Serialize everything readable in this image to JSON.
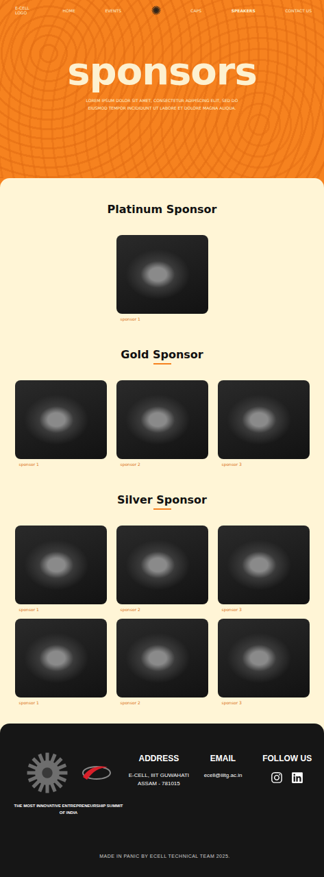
{
  "nav": {
    "logo": "E-CELL LOGO",
    "links_left": [
      {
        "label": "HOME",
        "selected": false
      },
      {
        "label": "EVENTS",
        "selected": false
      }
    ],
    "links_right": [
      {
        "label": "CAPS",
        "selected": false
      },
      {
        "label": "SPEAKERS",
        "selected": true
      },
      {
        "label": "CONTACT US",
        "selected": false
      }
    ]
  },
  "hero": {
    "title": "sponsors",
    "subtitle": "LOREM IPSUM DOLOR SIT AMET, CONSECTETUR ADIPISCING ELIT, SED DO EIUSMOD TEMPOR INCIDIDUNT UT LABORE ET DOLORE MAGNA ALIQUA."
  },
  "tiers": [
    {
      "title": "Platinum Sponsor",
      "underlined": false,
      "sponsors": [
        {
          "name": "sponsor 1"
        }
      ]
    },
    {
      "title": "Gold Sponsor",
      "underlined": true,
      "sponsors": [
        {
          "name": "sponsor 1"
        },
        {
          "name": "sponsor 2"
        },
        {
          "name": "sponsor 3"
        }
      ]
    },
    {
      "title": "Silver Sponsor",
      "underlined": true,
      "sponsors": [
        {
          "name": "sponsor 1"
        },
        {
          "name": "sponsor 2"
        },
        {
          "name": "sponsor 3"
        },
        {
          "name": "sponsor 1"
        },
        {
          "name": "sponsor 2"
        },
        {
          "name": "sponsor 3"
        }
      ]
    }
  ],
  "footer": {
    "tagline": "THE MOST INNOVATIVE ENTREPRENEURSHIP SUMMIT OF INDIA",
    "address": {
      "title": "ADDRESS",
      "lines": [
        "E-CELL, IIIT GUWAHATI",
        "ASSAM - 781015"
      ]
    },
    "email": {
      "title": "EMAIL",
      "value": "ecell@iiitg.ac.in"
    },
    "follow": {
      "title": "FOLLOW US"
    },
    "credit": "MADE IN PANIC BY ECELL TECHNICAL TEAM 2025."
  }
}
